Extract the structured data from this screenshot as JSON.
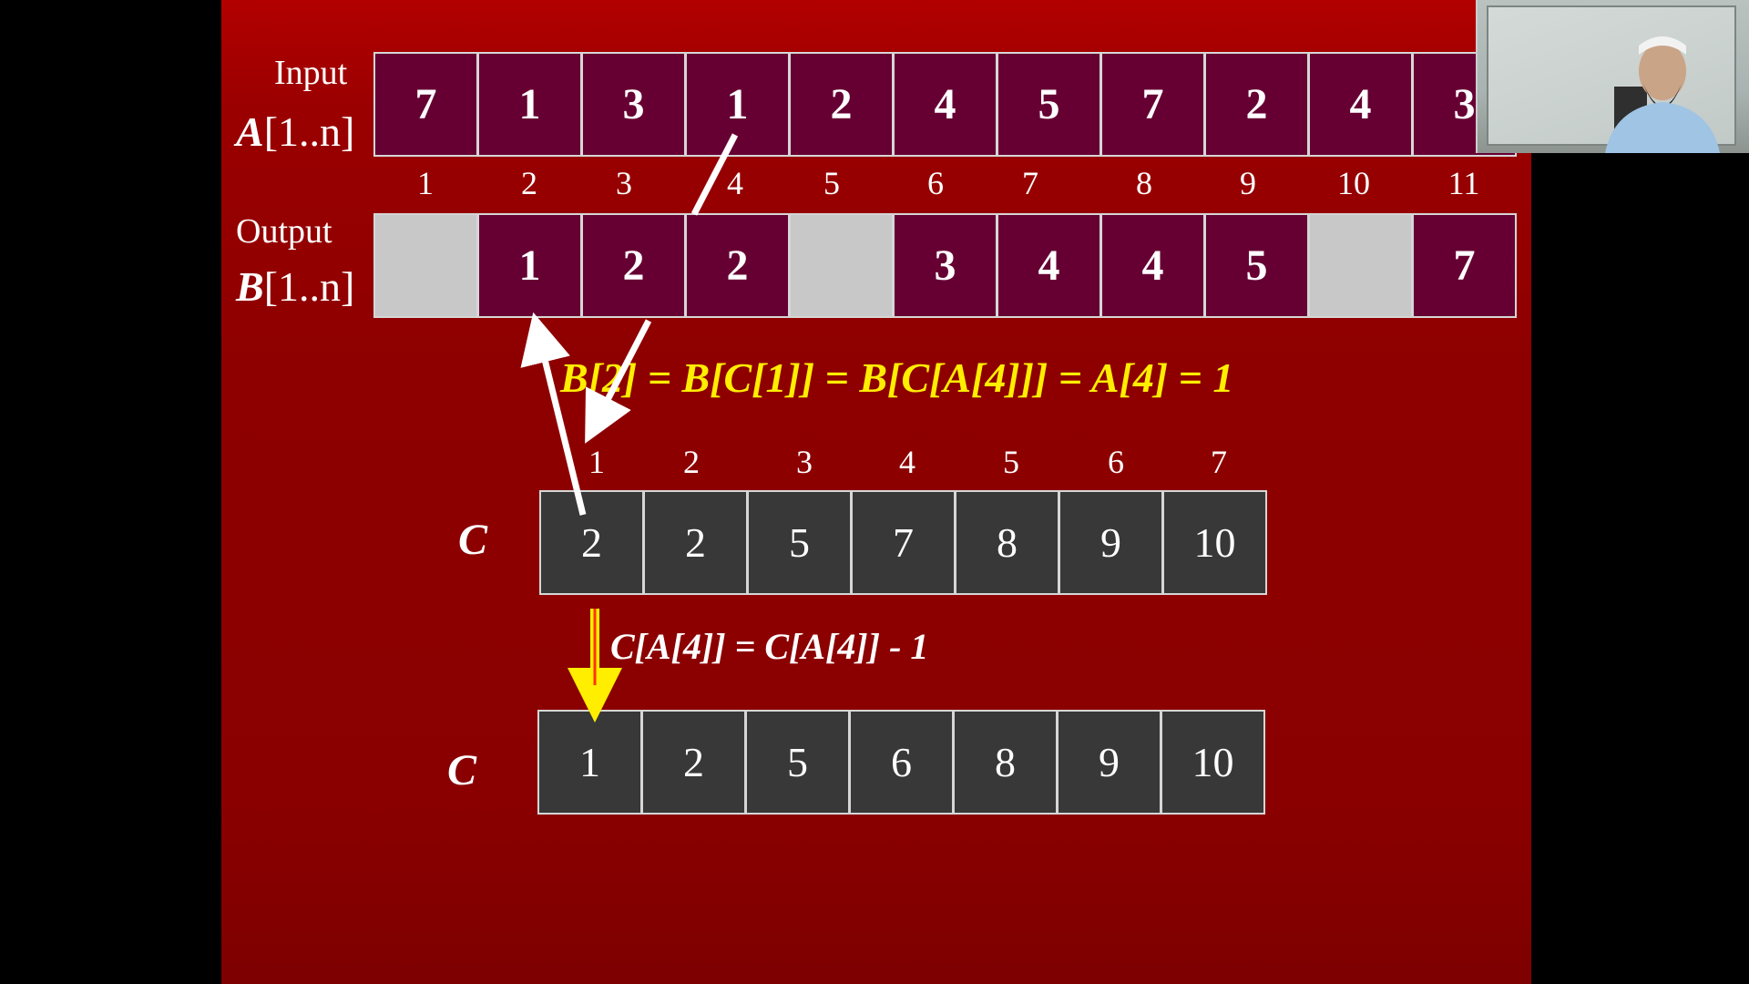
{
  "slide": {
    "input_label": "Input",
    "input_array_name": "A",
    "input_array_range": "[1..n]",
    "output_label": "Output",
    "output_array_name": "B",
    "output_array_range": "[1..n]",
    "array_A": [
      "7",
      "1",
      "3",
      "1",
      "2",
      "4",
      "5",
      "7",
      "2",
      "4",
      "3"
    ],
    "indices_A": [
      "1",
      "2",
      "3",
      "4",
      "5",
      "6",
      "7",
      "8",
      "9",
      "10",
      "11"
    ],
    "array_B": [
      "",
      "1",
      "2",
      "2",
      "",
      "3",
      "4",
      "4",
      "5",
      "",
      "7"
    ],
    "equation_1": "B[2] = B[C[1]] = B[C[A[4]]] = A[4] = 1",
    "indices_C": [
      "1",
      "2",
      "3",
      "4",
      "5",
      "6",
      "7"
    ],
    "C_label": "C",
    "array_C_before": [
      "2",
      "2",
      "5",
      "7",
      "8",
      "9",
      "10"
    ],
    "equation_2": "C[A[4]] = C[A[4]] - 1",
    "array_C_after": [
      "1",
      "2",
      "5",
      "6",
      "8",
      "9",
      "10"
    ]
  },
  "colors": {
    "slide_background": "#9a0000",
    "array_cell": "#660033",
    "empty_cell": "#c8c8c8",
    "count_cell": "#383838",
    "equation_highlight": "#ffee00",
    "arrow_white": "#ffffff",
    "arrow_yellow": "#ffee00"
  },
  "webcam": {
    "description_icon": "presenter-video-icon"
  }
}
